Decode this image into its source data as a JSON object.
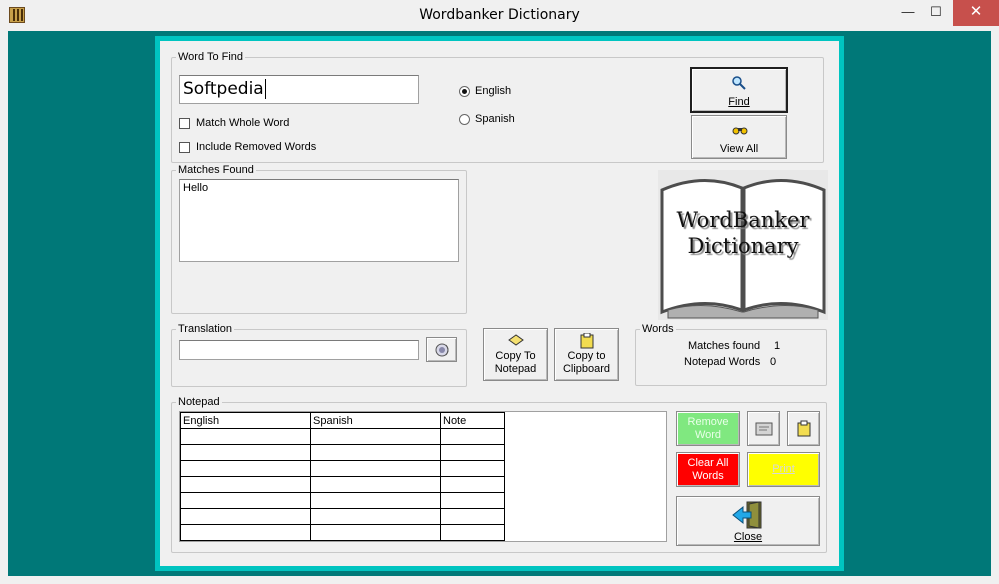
{
  "window": {
    "title": "Wordbanker Dictionary",
    "minimize": "—",
    "maximize": "☐",
    "close": "✕"
  },
  "find": {
    "group_label": "Word To Find",
    "word": "Softpedia",
    "match_whole_word": "Match Whole Word",
    "include_removed": "Include Removed Words",
    "language_english": "English",
    "language_spanish": "Spanish",
    "selected_language": "English",
    "find_button": "Find",
    "view_all_button": "View All"
  },
  "matches": {
    "group_label": "Matches Found",
    "items": [
      "Hello"
    ]
  },
  "logo": {
    "line1": "WordBanker",
    "line2": "Dictionary"
  },
  "translation": {
    "group_label": "Translation",
    "value": ""
  },
  "copy": {
    "to_notepad_line1": "Copy To",
    "to_notepad_line2": "Notepad",
    "to_clipboard_line1": "Copy to",
    "to_clipboard_line2": "Clipboard"
  },
  "words": {
    "group_label": "Words",
    "matches_found_label": "Matches found",
    "matches_found_value": "1",
    "notepad_words_label": "Notepad Words",
    "notepad_words_value": "0"
  },
  "notepad": {
    "group_label": "Notepad",
    "columns": [
      "English",
      "Spanish",
      "Note"
    ],
    "remove_word_line1": "Remove",
    "remove_word_line2": "Word",
    "clear_all_line1": "Clear All",
    "clear_all_line2": "Words",
    "print_label": "Print",
    "close_label": "Close"
  },
  "colors": {
    "client_bg": "#007878",
    "frame": "#00c4c0",
    "remove_button": "#80e880",
    "clear_button": "#ff0000",
    "print_button": "#ffff00"
  }
}
